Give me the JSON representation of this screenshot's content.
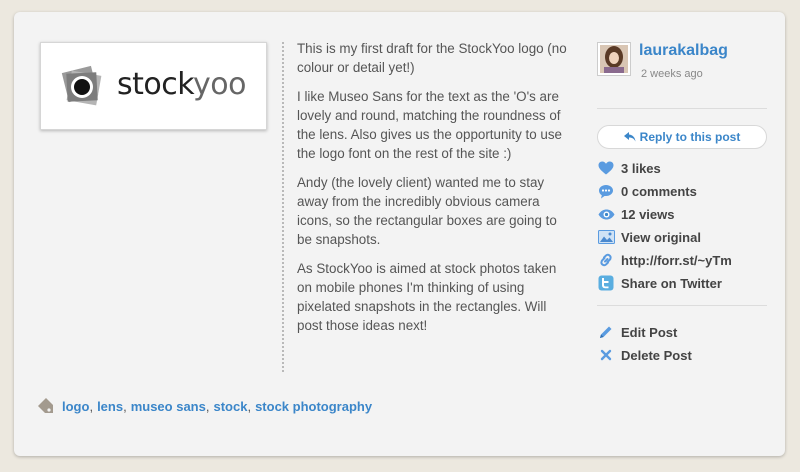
{
  "logo": {
    "word_dark": "stock",
    "word_light": "yoo"
  },
  "description": [
    "This is my first draft for the StockYoo logo (no colour or detail yet!)",
    "I like Museo Sans for the text as the 'O's are lovely and round, matching the roundness of the lens. Also gives us the opportunity to use the logo font on the rest of the site :)",
    "Andy (the lovely client) wanted me to stay away from the incredibly obvious camera icons, so the rectangular boxes are going to be snapshots.",
    "As StockYoo is aimed at stock photos taken on mobile phones I'm thinking of using pixelated snapshots in the rectangles. Will post those ideas next!"
  ],
  "author": {
    "name": "laurakalbag",
    "time": "2 weeks ago"
  },
  "reply_label": "Reply to this post",
  "stats": {
    "likes": "3 likes",
    "comments": "0 comments",
    "views": "12 views",
    "view_original": "View original",
    "short_url": "http://forr.st/~yTm",
    "share_twitter": "Share on Twitter"
  },
  "owner_actions": {
    "edit": "Edit Post",
    "delete": "Delete Post"
  },
  "tags": [
    "logo",
    "lens",
    "museo sans",
    "stock",
    "stock photography"
  ],
  "colors": {
    "link": "#3b86c9",
    "text": "#555555",
    "background": "#ece8df",
    "card": "#f3f3f3"
  }
}
